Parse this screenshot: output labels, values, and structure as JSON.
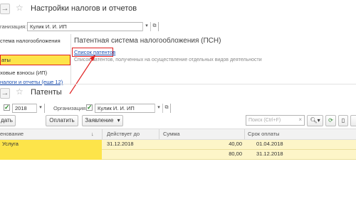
{
  "top_window": {
    "title": "Настройки налогов и отчетов",
    "org_label": "ганизация:",
    "org_value": "Кулик И. И. ИП",
    "sidebar_items": [
      "стема налогообложения",
      "аты",
      "ховые взносы (ИП)"
    ],
    "sidebar_more": "налоги и отчеты (еще 12)",
    "section_title": "Патентная система налогообложения (ПСН)",
    "patents_link": "Список патентов",
    "patents_desc": "Список патентов, полученных на осуществление отдельных видов деятельности"
  },
  "bottom_window": {
    "title": "Патенты",
    "year_value": "2018",
    "org_label": "Организация:",
    "org_value": "Кулик И. И. ИП",
    "buttons": {
      "create": "дать",
      "pay": "Оплатить",
      "statement": "Заявление",
      "statement_arrow": "▾"
    },
    "search_placeholder": "Поиск (Ctrl+F)",
    "columns": [
      "енование",
      "Действует до",
      "Сумма",
      "Срок оплаты"
    ],
    "rows": [
      {
        "name": "Услуга",
        "valid_until": "31.12.2018",
        "sum": "40,00",
        "due": "01.04.2018"
      },
      {
        "name": "",
        "valid_until": "",
        "sum": "80,00",
        "due": "31.12.2018"
      }
    ]
  },
  "icons": [
    "star-icon",
    "link-icon",
    "arrow-right-icon",
    "search-icon",
    "refresh-icon",
    "document-icon",
    "sort-down-icon"
  ],
  "colors": {
    "highlight_row": "#fde44a",
    "link": "#1a4fb4",
    "red_annotation": "#e02020",
    "check": "#2a8a2a"
  }
}
